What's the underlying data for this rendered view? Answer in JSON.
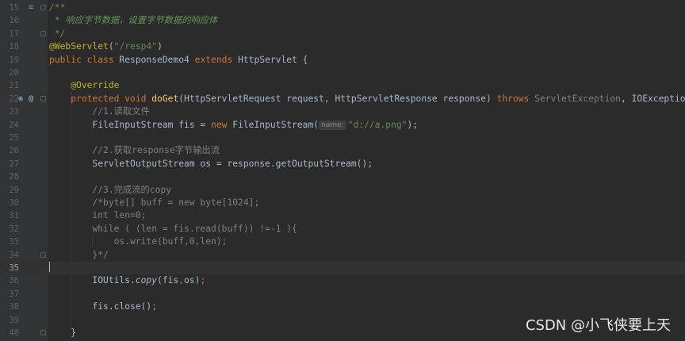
{
  "editor": {
    "lines": [
      {
        "num": "15",
        "tokens": [
          {
            "t": "/**",
            "c": "doc"
          }
        ]
      },
      {
        "num": "16",
        "tokens": [
          {
            "t": " * 响应字节数据，设置字节数据的响应体",
            "c": "doc"
          }
        ]
      },
      {
        "num": "17",
        "tokens": [
          {
            "t": " */",
            "c": "doc"
          }
        ]
      },
      {
        "num": "18",
        "tokens": [
          {
            "t": "@WebServlet",
            "c": "ann"
          },
          {
            "t": "(",
            "c": ""
          },
          {
            "t": "\"/resp4\"",
            "c": "str"
          },
          {
            "t": ")",
            "c": ""
          }
        ]
      },
      {
        "num": "19",
        "tokens": [
          {
            "t": "public class ",
            "c": "kw"
          },
          {
            "t": "ResponseDemo4 ",
            "c": ""
          },
          {
            "t": "extends ",
            "c": "kw"
          },
          {
            "t": "HttpServlet {",
            "c": ""
          }
        ]
      },
      {
        "num": "20",
        "tokens": []
      },
      {
        "num": "21",
        "tokens": [
          {
            "t": "    ",
            "c": ""
          },
          {
            "t": "@Override",
            "c": "ann"
          }
        ]
      },
      {
        "num": "22",
        "tokens": [
          {
            "t": "    ",
            "c": ""
          },
          {
            "t": "protected void ",
            "c": "kw"
          },
          {
            "t": "doGet",
            "c": "fn"
          },
          {
            "t": "(HttpServletRequest request, HttpServletResponse response) ",
            "c": ""
          },
          {
            "t": "throws ",
            "c": "kw"
          },
          {
            "t": "ServletException",
            "c": "dim"
          },
          {
            "t": ", IOException {",
            "c": ""
          }
        ]
      },
      {
        "num": "23",
        "tokens": [
          {
            "t": "        //1.读取文件",
            "c": "cmt"
          }
        ]
      },
      {
        "num": "24",
        "tokens": [
          {
            "t": "        FileInputStream fis = ",
            "c": ""
          },
          {
            "t": "new ",
            "c": "kw"
          },
          {
            "t": "FileInputStream(",
            "c": ""
          },
          {
            "t": "name:",
            "c": "hint"
          },
          {
            "t": "\"d://a.png\"",
            "c": "str"
          },
          {
            "t": ");",
            "c": ""
          }
        ]
      },
      {
        "num": "25",
        "tokens": []
      },
      {
        "num": "26",
        "tokens": [
          {
            "t": "        //2.获取response字节输出流",
            "c": "cmt"
          }
        ]
      },
      {
        "num": "27",
        "tokens": [
          {
            "t": "        ServletOutputStream os = response.getOutputStream();",
            "c": ""
          }
        ]
      },
      {
        "num": "28",
        "tokens": []
      },
      {
        "num": "29",
        "tokens": [
          {
            "t": "        //3.完成流的copy",
            "c": "cmt"
          }
        ]
      },
      {
        "num": "30",
        "tokens": [
          {
            "t": "        /*byte[] buff = new byte[1024];",
            "c": "cmt"
          }
        ]
      },
      {
        "num": "31",
        "tokens": [
          {
            "t": "        int len=0;",
            "c": "cmt"
          }
        ]
      },
      {
        "num": "32",
        "tokens": [
          {
            "t": "        while ( (len = fis.read(buff)) !=-1 ){",
            "c": "cmt"
          }
        ]
      },
      {
        "num": "33",
        "tokens": [
          {
            "t": "            os.write(buff,0,len);",
            "c": "cmt"
          }
        ]
      },
      {
        "num": "34",
        "tokens": [
          {
            "t": "        }*/",
            "c": "cmt"
          }
        ]
      },
      {
        "num": "35",
        "tokens": [],
        "current": true
      },
      {
        "num": "36",
        "tokens": [
          {
            "t": "        IOUtils.",
            "c": ""
          },
          {
            "t": "copy",
            "c": "it"
          },
          {
            "t": "(fis",
            "c": ""
          },
          {
            "t": ",",
            "c": "kw"
          },
          {
            "t": "os)",
            "c": ""
          },
          {
            "t": ";",
            "c": "kw"
          }
        ]
      },
      {
        "num": "37",
        "tokens": []
      },
      {
        "num": "38",
        "tokens": [
          {
            "t": "        fis.close()",
            "c": ""
          },
          {
            "t": ";",
            "c": "kw"
          }
        ]
      },
      {
        "num": "39",
        "tokens": []
      },
      {
        "num": "40",
        "tokens": [
          {
            "t": "    }",
            "c": ""
          }
        ]
      }
    ]
  },
  "watermark": "CSDN @小飞侠要上天"
}
